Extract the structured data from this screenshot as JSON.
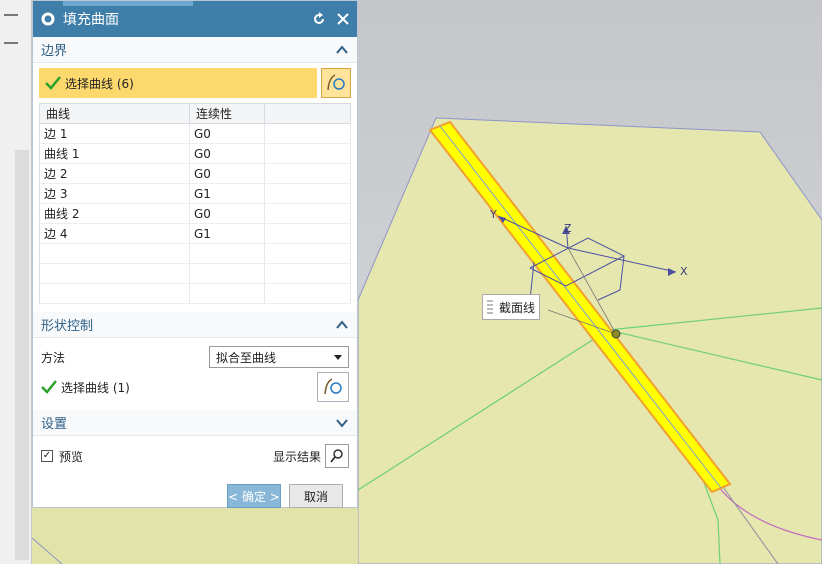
{
  "dialog": {
    "title": "填充曲面"
  },
  "boundary": {
    "title": "边界",
    "select_label": "选择曲线 (6)",
    "table": {
      "headers": [
        "曲线",
        "连续性"
      ],
      "rows": [
        {
          "curve": "边 1",
          "continuity": "G0"
        },
        {
          "curve": "曲线 1",
          "continuity": "G0"
        },
        {
          "curve": "边 2",
          "continuity": "G0"
        },
        {
          "curve": "边 3",
          "continuity": "G1"
        },
        {
          "curve": "曲线 2",
          "continuity": "G0"
        },
        {
          "curve": "边 4",
          "continuity": "G1"
        }
      ]
    }
  },
  "shape": {
    "title": "形状控制",
    "method_label": "方法",
    "method_value": "拟合至曲线",
    "select_label": "选择曲线 (1)"
  },
  "settings": {
    "title": "设置",
    "preview_label": "预览",
    "show_result_label": "显示结果"
  },
  "buttons": {
    "ok": "< 确定 >",
    "cancel": "取消"
  },
  "viewport": {
    "tooltip": "截面线",
    "axis_x": "X",
    "axis_y": "Y",
    "axis_z": "Z"
  },
  "colors": {
    "titlebar": "#3e7ea8",
    "selection": "#fdd96d",
    "surface": "#e6e7ae",
    "highlight": "#ffff00"
  }
}
